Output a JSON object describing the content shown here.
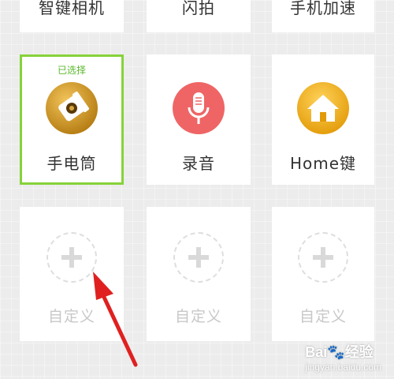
{
  "tiles": {
    "row0": [
      {
        "label": "智键相机"
      },
      {
        "label": "闪拍"
      },
      {
        "label": "手机加速"
      }
    ],
    "row1": [
      {
        "label": "手电筒",
        "tag": "已选择",
        "icon": "flashlight-icon"
      },
      {
        "label": "录音",
        "icon": "microphone-icon"
      },
      {
        "label": "Home键",
        "icon": "home-icon"
      }
    ],
    "row2": [
      {
        "label": "自定义",
        "icon": "add-icon"
      },
      {
        "label": "自定义",
        "icon": "add-icon"
      },
      {
        "label": "自定义",
        "icon": "add-icon"
      }
    ]
  },
  "colors": {
    "selected_border": "#86d23a",
    "flashlight_gold": "#d39a1c",
    "record_red": "#ef6565",
    "home_yellow": "#f3b81c",
    "arrow_red": "#e02020"
  },
  "watermark": {
    "brand": "Bai",
    "suffix": "经验",
    "sub": "jingyan.baidu.com"
  }
}
